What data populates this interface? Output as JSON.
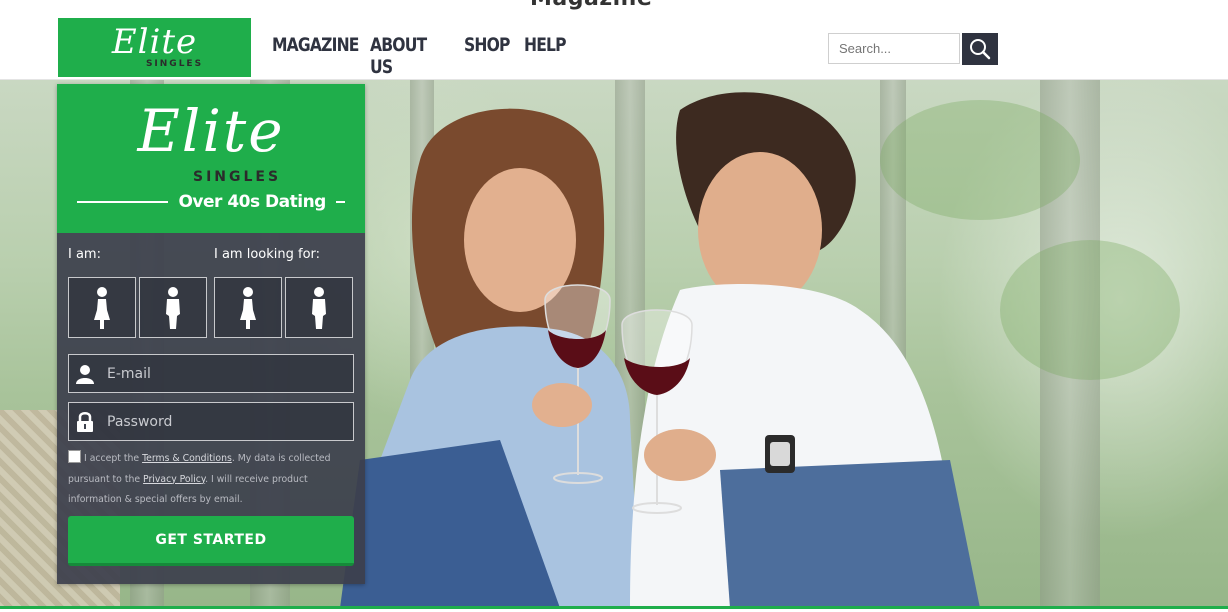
{
  "top_peek": "Magazine",
  "header": {
    "logo_script": "Elite",
    "logo_sub": "SINGLES",
    "nav": [
      "MAGAZINE",
      "ABOUT US",
      "SHOP",
      "HELP"
    ],
    "search_placeholder": "Search...",
    "search_icon": "magnifier-icon"
  },
  "panel": {
    "logo_script": "Elite",
    "logo_sub": "SINGLES",
    "tagline": "Over 40s Dating",
    "i_am_label": "I am:",
    "looking_for_label": "I am looking for:",
    "gender_icons": [
      "female-icon",
      "male-icon",
      "female-icon",
      "male-icon"
    ],
    "email_placeholder": "E-mail",
    "password_placeholder": "Password",
    "consent": {
      "part1": "I accept the ",
      "terms_link": "Terms & Conditions",
      "part2": ". My data is collected pursuant to the ",
      "privacy_link": "Privacy Policy",
      "part3": ". I will receive product information & special offers by email."
    },
    "cta_label": "GET STARTED"
  },
  "colors": {
    "brand_green": "#1fae4b",
    "nav_text": "#2f3340",
    "panel_bg": "#3c404c"
  }
}
